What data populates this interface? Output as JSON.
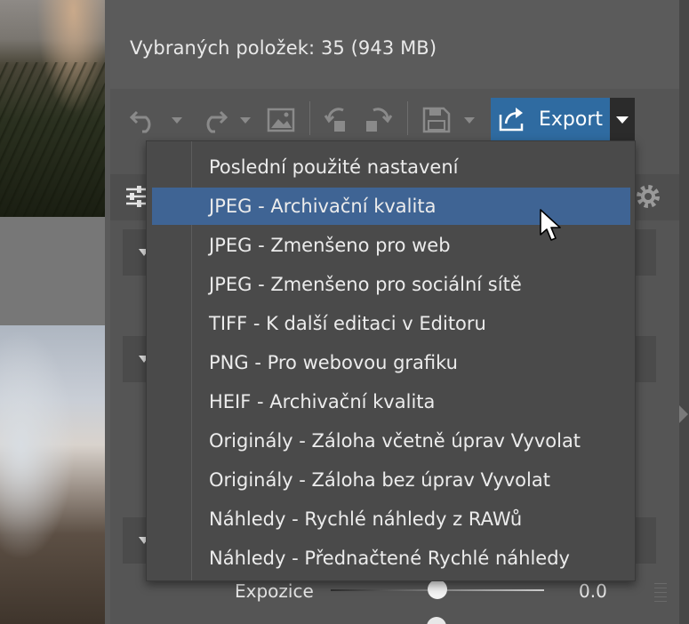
{
  "header": {
    "selected_count": "Vybraných položek: 35 (943 MB)"
  },
  "toolbar": {
    "undo_icon": "undo-icon",
    "redo_icon": "redo-icon",
    "image_icon": "image-icon",
    "rotate_left_icon": "rotate-left-icon",
    "rotate_right_icon": "rotate-right-icon",
    "save_icon": "save-icon",
    "export_icon": "export-share-icon",
    "export_label": "Export",
    "export_button_color": "#2f6ba1"
  },
  "export_menu": {
    "highlight_color": "#3f6494",
    "items": [
      {
        "label": "Poslední použité nastavení",
        "active": false
      },
      {
        "label": "JPEG - Archivační kvalita",
        "active": true
      },
      {
        "label": "JPEG - Zmenšeno pro web",
        "active": false
      },
      {
        "label": "JPEG - Zmenšeno pro sociální sítě",
        "active": false
      },
      {
        "label": "TIFF - K další editaci v Editoru",
        "active": false
      },
      {
        "label": "PNG - Pro webovou grafiku",
        "active": false
      },
      {
        "label": "HEIF - Archivační kvalita",
        "active": false
      },
      {
        "label": "Originály - Záloha včetně úprav Vyvolat",
        "active": false
      },
      {
        "label": "Originály - Záloha bez úprav Vyvolat",
        "active": false
      },
      {
        "label": "Náhledy - Rychlé náhledy z RAWů",
        "active": false
      },
      {
        "label": "Náhledy - Přednačtené Rychlé náhledy",
        "active": false
      }
    ]
  },
  "panel": {
    "exposure_label": "Expozice",
    "exposure_value": "0.0",
    "exposure_slider_fraction": 0.5
  }
}
